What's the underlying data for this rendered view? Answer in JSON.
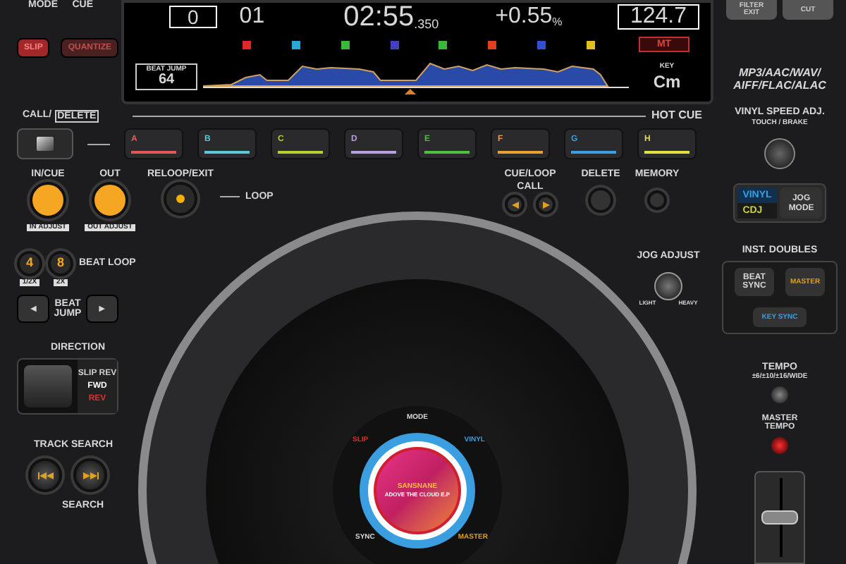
{
  "top_left": {
    "mode_label": "MODE",
    "cue_label": "CUE",
    "buttons": [
      {
        "label": "SLIP",
        "on": true
      },
      {
        "label": "QUANTIZE",
        "on": false
      }
    ]
  },
  "screen": {
    "track_box": "0",
    "track_number": "01",
    "time": "02:55",
    "time_ms": ".350",
    "tempo": "+0.55",
    "tempo_unit": "%",
    "bpm": "124.7",
    "beat_jump_label": "BEAT JUMP",
    "beat_jump": "64",
    "mt": "MT",
    "key_label": "KEY",
    "key": "Cm",
    "memory_cues": [
      {
        "color": "#e02828"
      },
      {
        "color": "#2aa8d8"
      },
      {
        "color": "#3ab83a"
      },
      {
        "color": "#4040c0"
      },
      {
        "color": "#3ab83a"
      },
      {
        "color": "#e04020"
      },
      {
        "color": "#3050d0"
      },
      {
        "color": "#e0c020"
      }
    ]
  },
  "top_right": {
    "buttons": [
      {
        "label": "FILTER",
        "sublabel": "EXIT"
      },
      {
        "label": "CUT"
      }
    ],
    "formats": [
      "MP3/AAC/WAV/",
      "AIFF/FLAC/ALAC"
    ]
  },
  "hot_cue": {
    "title": "HOT CUE",
    "call_label": "CALL/",
    "delete_label": "DELETE",
    "pads": [
      {
        "label": "A",
        "color": "#e05a5a"
      },
      {
        "label": "B",
        "color": "#5ac8d8"
      },
      {
        "label": "C",
        "color": "#b8d030"
      },
      {
        "label": "D",
        "color": "#b8a0e0"
      },
      {
        "label": "E",
        "color": "#50c040"
      },
      {
        "label": "F",
        "color": "#e8a030"
      },
      {
        "label": "G",
        "color": "#3a9ee0"
      },
      {
        "label": "H",
        "color": "#e0e040"
      }
    ]
  },
  "vinyl_speed": {
    "title": "VINYL SPEED ADJ.",
    "subtitle": "TOUCH / BRAKE"
  },
  "loop": {
    "in_cue": "IN/CUE",
    "out": "OUT",
    "reloop": "RELOOP/EXIT",
    "loop": "LOOP",
    "in_adjust": "IN ADJUST",
    "out_adjust": "OUT ADJUST"
  },
  "cue_loop": {
    "call_title": "CUE/LOOP",
    "call_title_2": "CALL",
    "delete": "DELETE",
    "memory": "MEMORY"
  },
  "jog_mode": {
    "options": [
      {
        "label": "VINYL",
        "selected": true,
        "color": "#3a9ee0"
      },
      {
        "label": "CDJ",
        "selected": false,
        "color": "#c8d040"
      }
    ],
    "button": [
      "JOG",
      "MODE"
    ]
  },
  "beat_loop": {
    "title": "BEAT LOOP",
    "buttons": [
      {
        "label": "4",
        "sub": "1/2X"
      },
      {
        "label": "8",
        "sub": "2X"
      }
    ]
  },
  "beat_jump": {
    "left": "◄",
    "right": "►",
    "title": [
      "BEAT",
      "JUMP"
    ]
  },
  "direction": {
    "title": "DIRECTION",
    "options": [
      {
        "label": "SLIP REV",
        "color": "#d0d0d0"
      },
      {
        "label": "FWD",
        "color": "#ffffff"
      },
      {
        "label": "REV",
        "color": "#e03030"
      }
    ]
  },
  "track_search": {
    "title": "TRACK SEARCH"
  },
  "search": {
    "title": "SEARCH"
  },
  "jog_adjust": {
    "title": "JOG ADJUST",
    "light": "LIGHT",
    "heavy": "HEAVY"
  },
  "jog": {
    "mode": "MODE",
    "slip": "SLIP",
    "vinyl": "VINYL",
    "sync": "SYNC",
    "master": "MASTER",
    "artist": "SANSNANE",
    "album": "ADOVE THE CLOUD E.P"
  },
  "inst_doubles": {
    "title": "INST. DOUBLES",
    "beat_sync": [
      "BEAT",
      "SYNC"
    ],
    "master": "MASTER",
    "key_sync": "KEY SYNC"
  },
  "tempo": {
    "title": "TEMPO",
    "ranges": "±6/±10/±16/WIDE",
    "master_tempo": [
      "MASTER",
      "TEMPO"
    ],
    "master_tempo_on": true,
    "level": 0.5
  }
}
